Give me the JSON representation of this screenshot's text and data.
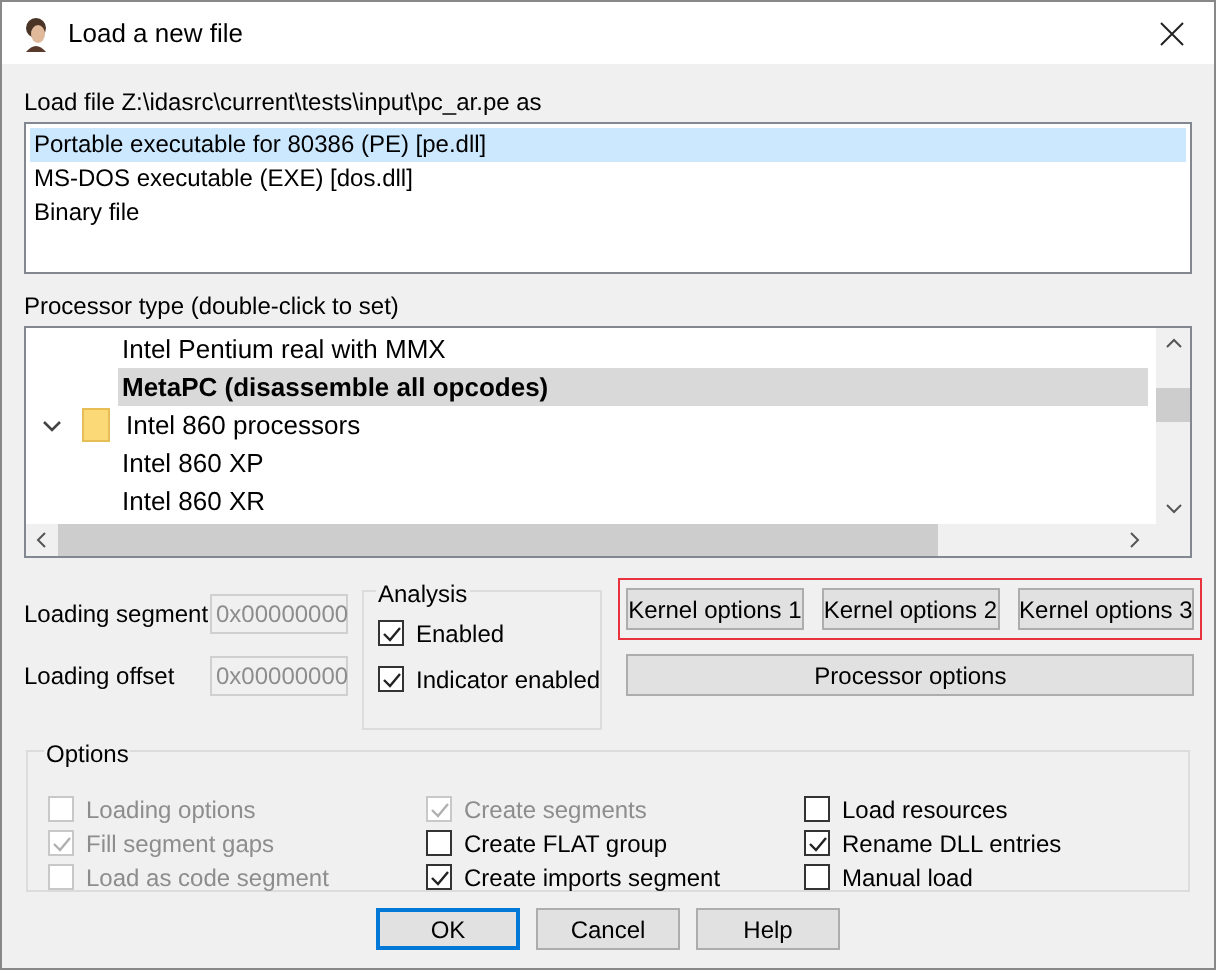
{
  "window": {
    "title": "Load a new file"
  },
  "load_file_label": "Load file Z:\\idasrc\\current\\tests\\input\\pc_ar.pe as",
  "loaders": [
    {
      "label": "Portable executable for 80386 (PE) [pe.dll]",
      "selected": true
    },
    {
      "label": "MS-DOS executable (EXE) [dos.dll]",
      "selected": false
    },
    {
      "label": "Binary file",
      "selected": false
    }
  ],
  "processor_label": "Processor type (double-click to set)",
  "processor_tree": [
    {
      "label": "Intel Pentium real with MMX",
      "selected": false
    },
    {
      "label": "MetaPC (disassemble all opcodes)",
      "selected": true
    },
    {
      "label": "Intel 860 processors",
      "selected": false,
      "expanded": true,
      "children": [
        {
          "label": "Intel 860 XP",
          "selected": false
        },
        {
          "label": "Intel 860 XR",
          "selected": false
        }
      ]
    }
  ],
  "fields": [
    {
      "label": "Loading segment",
      "value": "0x00000000"
    },
    {
      "label": "Loading offset",
      "value": "0x00000000"
    }
  ],
  "analysis": {
    "title": "Analysis",
    "options": [
      {
        "label": "Enabled",
        "checked": true
      },
      {
        "label": "Indicator enabled",
        "checked": true
      }
    ]
  },
  "kernel_buttons": [
    "Kernel options 1",
    "Kernel options 2",
    "Kernel options 3"
  ],
  "processor_options_button": "Processor options",
  "options": {
    "title": "Options",
    "columns": [
      [
        {
          "label": "Loading options",
          "checked": false,
          "disabled": true
        },
        {
          "label": "Fill segment gaps",
          "checked": true,
          "disabled": true
        },
        {
          "label": "Load as code segment",
          "checked": false,
          "disabled": true
        }
      ],
      [
        {
          "label": "Create segments",
          "checked": true,
          "disabled": true
        },
        {
          "label": "Create FLAT group",
          "checked": false,
          "disabled": false
        },
        {
          "label": "Create imports segment",
          "checked": true,
          "disabled": false
        }
      ],
      [
        {
          "label": "Load resources",
          "checked": false,
          "disabled": false
        },
        {
          "label": "Rename DLL entries",
          "checked": true,
          "disabled": false
        },
        {
          "label": "Manual load",
          "checked": false,
          "disabled": false
        }
      ]
    ]
  },
  "buttons": [
    {
      "label": "OK",
      "default": true
    },
    {
      "label": "Cancel",
      "default": false
    },
    {
      "label": "Help",
      "default": false
    }
  ]
}
